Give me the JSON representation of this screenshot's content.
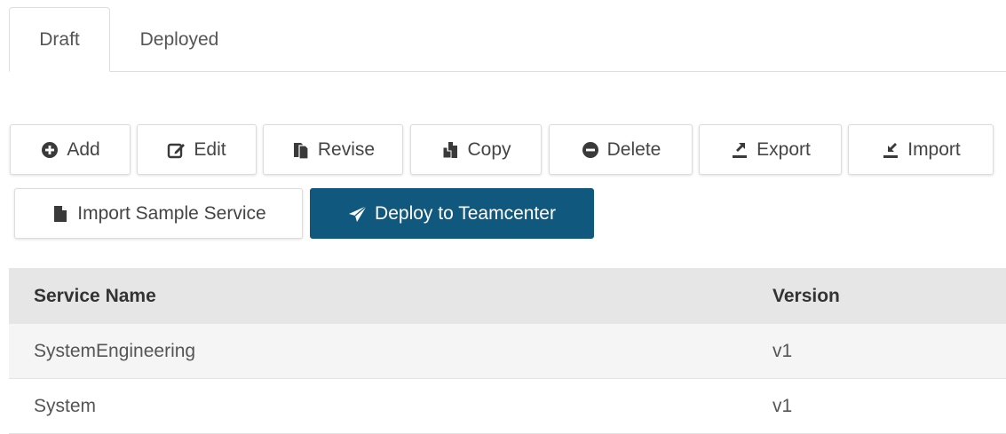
{
  "tabs": [
    {
      "label": "Draft",
      "active": true
    },
    {
      "label": "Deployed",
      "active": false
    }
  ],
  "toolbar": {
    "add": "Add",
    "edit": "Edit",
    "revise": "Revise",
    "copy": "Copy",
    "delete": "Delete",
    "export": "Export",
    "import": "Import",
    "import_sample": "Import Sample Service",
    "deploy": "Deploy to Teamcenter"
  },
  "table": {
    "columns": {
      "name": "Service Name",
      "version": "Version"
    },
    "rows": [
      {
        "name": "SystemEngineering",
        "version": "v1"
      },
      {
        "name": "System",
        "version": "v1"
      }
    ]
  },
  "colors": {
    "primary": "#11587f",
    "header_bg": "#e6e6e6",
    "row_alt_bg": "#f5f5f5"
  },
  "icons": {
    "add": "plus-circle-icon",
    "edit": "edit-icon",
    "revise": "revise-icon",
    "copy": "copy-icon",
    "delete": "minus-circle-icon",
    "export": "export-icon",
    "import": "import-icon",
    "import_sample": "file-icon",
    "deploy": "paper-plane-icon"
  }
}
